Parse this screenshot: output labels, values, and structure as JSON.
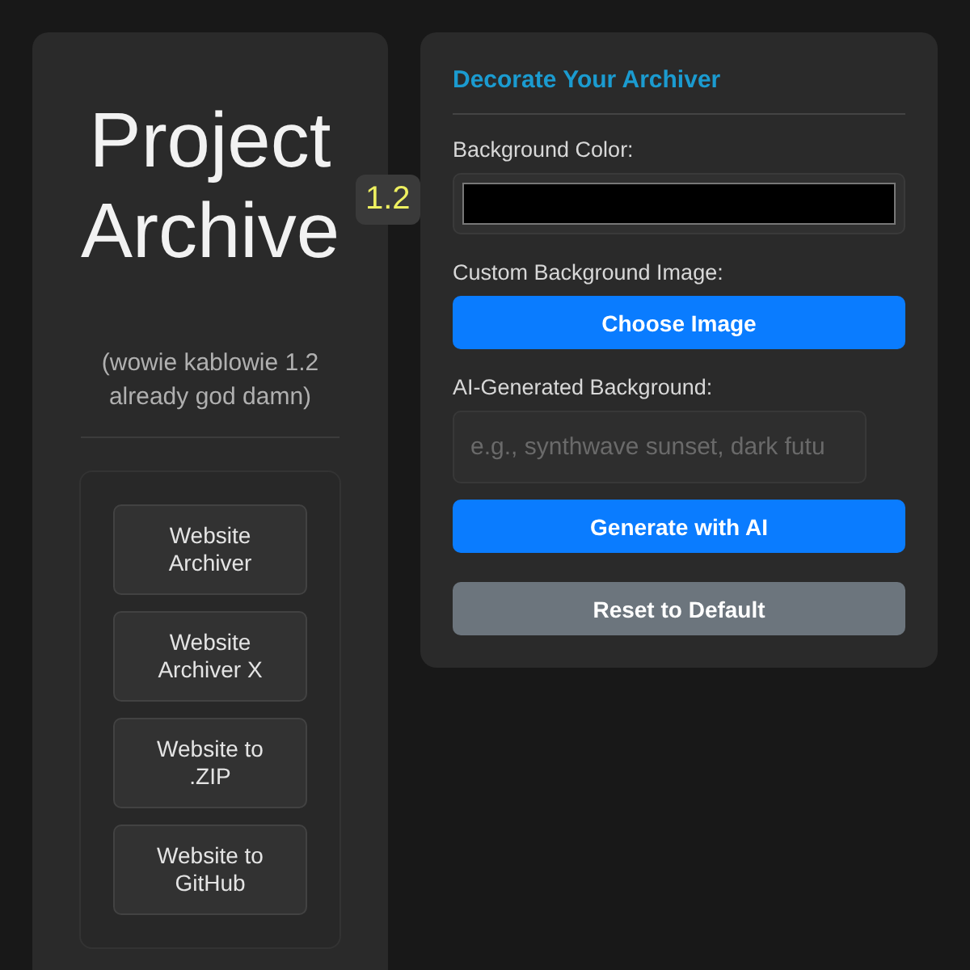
{
  "sidebar": {
    "title": "Project Archive",
    "version_badge": "1.2",
    "subtitle": "(wowie kablowie 1.2 already god damn)",
    "nav_buttons": [
      "Website Archiver",
      "Website Archiver X",
      "Website to .ZIP",
      "Website to GitHub"
    ]
  },
  "decorate_panel": {
    "heading": "Decorate Your Archiver",
    "background_color": {
      "label": "Background Color:"
    },
    "custom_image": {
      "label": "Custom Background Image:",
      "button": "Choose Image"
    },
    "ai_background": {
      "label": "AI-Generated Background:",
      "placeholder": "e.g., synthwave sunset, dark futu",
      "button": "Generate with AI"
    },
    "reset_button": "Reset to Default"
  }
}
